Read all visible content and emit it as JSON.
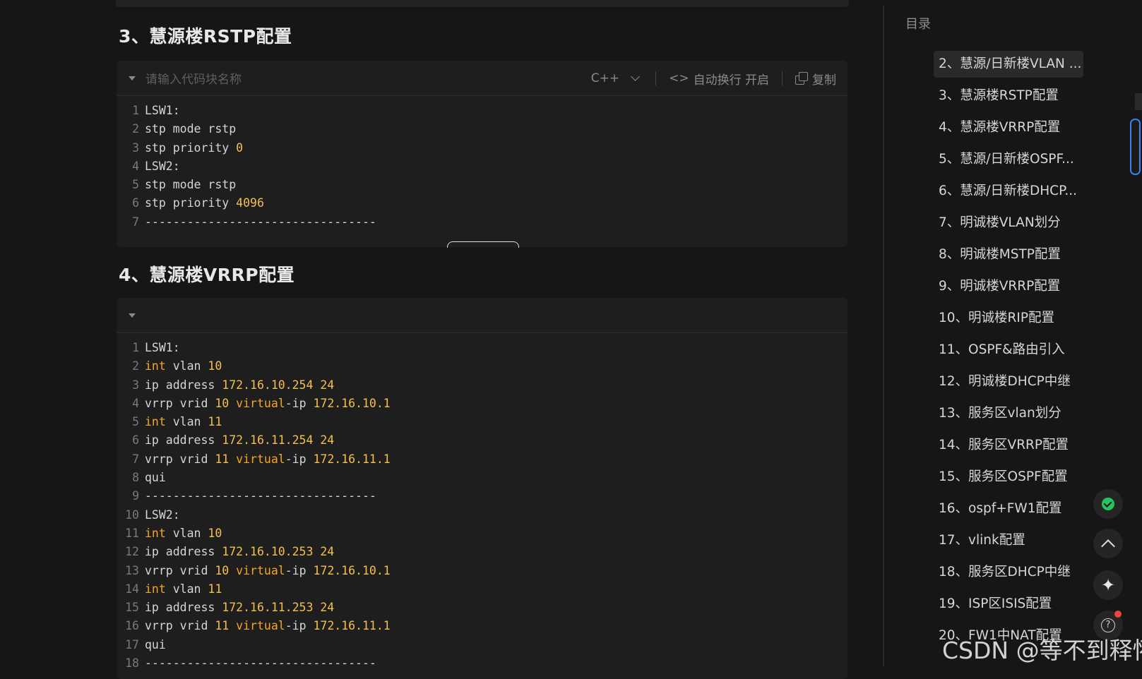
{
  "sections": [
    {
      "heading": "3、慧源楼RSTP配置",
      "code_header": {
        "name_placeholder": "请输入代码块名称",
        "language": "C++",
        "wrap_label": "自动换行 开启",
        "copy_label": "复制"
      },
      "lines": [
        {
          "n": "1",
          "t": [
            {
              "s": "LSW1:",
              "c": "txt"
            }
          ]
        },
        {
          "n": "2",
          "t": [
            {
              "s": "stp mode rstp",
              "c": "txt"
            }
          ]
        },
        {
          "n": "3",
          "t": [
            {
              "s": "stp priority ",
              "c": "txt"
            },
            {
              "s": "0",
              "c": "num"
            }
          ]
        },
        {
          "n": "4",
          "t": [
            {
              "s": "LSW2:",
              "c": "txt"
            }
          ]
        },
        {
          "n": "5",
          "t": [
            {
              "s": "stp mode rstp",
              "c": "txt"
            }
          ]
        },
        {
          "n": "6",
          "t": [
            {
              "s": "stp priority ",
              "c": "txt"
            },
            {
              "s": "4096",
              "c": "num"
            }
          ]
        },
        {
          "n": "7",
          "t": [
            {
              "s": "---------------------------------",
              "c": "txt"
            }
          ]
        }
      ]
    },
    {
      "heading": "4、慧源楼VRRP配置",
      "lines": [
        {
          "n": "1",
          "t": [
            {
              "s": "LSW1:",
              "c": "txt"
            }
          ]
        },
        {
          "n": "2",
          "t": [
            {
              "s": "int",
              "c": "kw"
            },
            {
              "s": " vlan ",
              "c": "txt"
            },
            {
              "s": "10",
              "c": "num"
            }
          ]
        },
        {
          "n": "3",
          "t": [
            {
              "s": "ip address ",
              "c": "txt"
            },
            {
              "s": "172.16.10.254",
              "c": "num"
            },
            {
              "s": " ",
              "c": "txt"
            },
            {
              "s": "24",
              "c": "num"
            }
          ]
        },
        {
          "n": "4",
          "t": [
            {
              "s": "vrrp vrid ",
              "c": "txt"
            },
            {
              "s": "10",
              "c": "num"
            },
            {
              "s": " ",
              "c": "txt"
            },
            {
              "s": "virtual",
              "c": "kw"
            },
            {
              "s": "-ip ",
              "c": "txt"
            },
            {
              "s": "172.16.10.1",
              "c": "num"
            }
          ]
        },
        {
          "n": "5",
          "t": [
            {
              "s": "int",
              "c": "kw"
            },
            {
              "s": " vlan ",
              "c": "txt"
            },
            {
              "s": "11",
              "c": "num"
            }
          ]
        },
        {
          "n": "6",
          "t": [
            {
              "s": "ip address ",
              "c": "txt"
            },
            {
              "s": "172.16.11.254",
              "c": "num"
            },
            {
              "s": " ",
              "c": "txt"
            },
            {
              "s": "24",
              "c": "num"
            }
          ]
        },
        {
          "n": "7",
          "t": [
            {
              "s": "vrrp vrid ",
              "c": "txt"
            },
            {
              "s": "11",
              "c": "num"
            },
            {
              "s": " ",
              "c": "txt"
            },
            {
              "s": "virtual",
              "c": "kw"
            },
            {
              "s": "-ip ",
              "c": "txt"
            },
            {
              "s": "172.16.11.1",
              "c": "num"
            }
          ]
        },
        {
          "n": "8",
          "t": [
            {
              "s": "qui",
              "c": "txt"
            }
          ]
        },
        {
          "n": "9",
          "t": [
            {
              "s": "---------------------------------",
              "c": "txt"
            }
          ]
        },
        {
          "n": "10",
          "t": [
            {
              "s": "LSW2:",
              "c": "txt"
            }
          ]
        },
        {
          "n": "11",
          "t": [
            {
              "s": "int",
              "c": "kw"
            },
            {
              "s": " vlan ",
              "c": "txt"
            },
            {
              "s": "10",
              "c": "num"
            }
          ]
        },
        {
          "n": "12",
          "t": [
            {
              "s": "ip address ",
              "c": "txt"
            },
            {
              "s": "172.16.10.253",
              "c": "num"
            },
            {
              "s": " ",
              "c": "txt"
            },
            {
              "s": "24",
              "c": "num"
            }
          ]
        },
        {
          "n": "13",
          "t": [
            {
              "s": "vrrp vrid ",
              "c": "txt"
            },
            {
              "s": "10",
              "c": "num"
            },
            {
              "s": " ",
              "c": "txt"
            },
            {
              "s": "virtual",
              "c": "kw"
            },
            {
              "s": "-ip ",
              "c": "txt"
            },
            {
              "s": "172.16.10.1",
              "c": "num"
            }
          ]
        },
        {
          "n": "14",
          "t": [
            {
              "s": "int",
              "c": "kw"
            },
            {
              "s": " vlan ",
              "c": "txt"
            },
            {
              "s": "11",
              "c": "num"
            }
          ]
        },
        {
          "n": "15",
          "t": [
            {
              "s": "ip address ",
              "c": "txt"
            },
            {
              "s": "172.16.11.253",
              "c": "num"
            },
            {
              "s": " ",
              "c": "txt"
            },
            {
              "s": "24",
              "c": "num"
            }
          ]
        },
        {
          "n": "16",
          "t": [
            {
              "s": "vrrp vrid ",
              "c": "txt"
            },
            {
              "s": "11",
              "c": "num"
            },
            {
              "s": " ",
              "c": "txt"
            },
            {
              "s": "virtual",
              "c": "kw"
            },
            {
              "s": "-ip ",
              "c": "txt"
            },
            {
              "s": "172.16.11.1",
              "c": "num"
            }
          ]
        },
        {
          "n": "17",
          "t": [
            {
              "s": "qui",
              "c": "txt"
            }
          ]
        },
        {
          "n": "18",
          "t": [
            {
              "s": "---------------------------------",
              "c": "txt"
            }
          ]
        }
      ]
    }
  ],
  "toc": {
    "title": "目录",
    "active_index": 0,
    "items": [
      "2、慧源/日新楼VLAN ...",
      "3、慧源楼RSTP配置",
      "4、慧源楼VRRP配置",
      "5、慧源/日新楼OSPF...",
      "6、慧源/日新楼DHCP...",
      "7、明诚楼VLAN划分",
      "8、明诚楼MSTP配置",
      "9、明诚楼VRRP配置",
      "10、明诚楼RIP配置",
      "11、OSPF&路由引入",
      "12、明诚楼DHCP中继",
      "13、服务区vlan划分",
      "14、服务区VRRP配置",
      "15、服务区OSPF配置",
      "16、ospf+FW1配置",
      "17、vlink配置",
      "18、服务区DHCP中继",
      "19、ISP区ISIS配置",
      "20、FW1中NAT配置"
    ]
  },
  "floating_buttons": [
    "check-circle-icon",
    "chevron-up-icon",
    "sparkle-icon",
    "help-circle-icon"
  ],
  "watermark": "CSDN @等不到释怀",
  "colors": {
    "background": "#161616",
    "code_bg": "#1e1e1e",
    "keyword": "#f5a623",
    "number": "#f5c04a",
    "accent_blue": "#3b82f6",
    "success": "#22c55e",
    "notification": "#ef4444"
  }
}
